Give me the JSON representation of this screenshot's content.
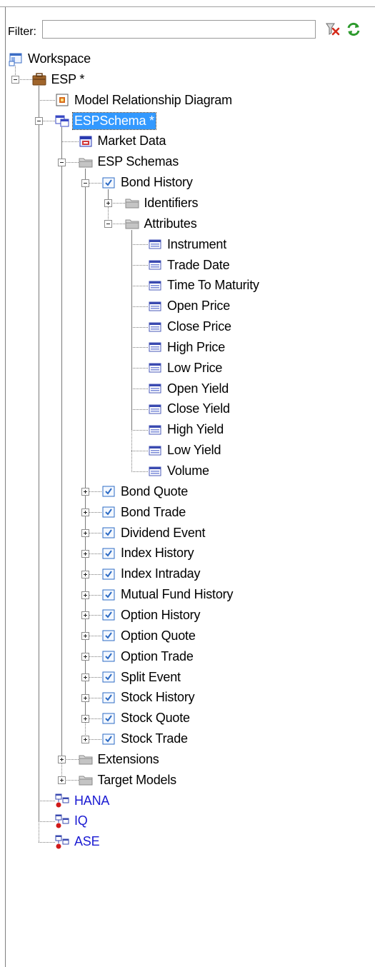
{
  "filter": {
    "label": "Filter:",
    "value": "",
    "clear_icon": "clear-filter-icon",
    "refresh_icon": "refresh-icon"
  },
  "colors": {
    "selection": "#3399ff",
    "model_link_text": "#1a1ad2"
  },
  "tree": [
    {
      "label": "Workspace",
      "icon": "workspace-icon",
      "level": 0,
      "toggle": "none"
    },
    {
      "label": "ESP *",
      "icon": "project-folder-icon",
      "level": 1,
      "toggle": "expanded"
    },
    {
      "label": "Model Relationship Diagram",
      "icon": "diagram-icon",
      "level": 2,
      "toggle": "none"
    },
    {
      "label": "ESPSchema *",
      "icon": "schema-icon",
      "level": 2,
      "toggle": "expanded",
      "selected": true
    },
    {
      "label": "Market Data",
      "icon": "database-icon",
      "level": 3,
      "toggle": "none"
    },
    {
      "label": "ESP Schemas",
      "icon": "folder-icon",
      "level": 3,
      "toggle": "expanded"
    },
    {
      "label": "Bond History",
      "icon": "schema-check-icon",
      "level": 4,
      "toggle": "expanded"
    },
    {
      "label": "Identifiers",
      "icon": "folder-icon",
      "level": 5,
      "toggle": "collapsed"
    },
    {
      "label": "Attributes",
      "icon": "folder-icon",
      "level": 5,
      "toggle": "expanded"
    },
    {
      "label": "Instrument",
      "icon": "attribute-icon",
      "level": 6,
      "toggle": "none"
    },
    {
      "label": "Trade Date",
      "icon": "attribute-icon",
      "level": 6,
      "toggle": "none"
    },
    {
      "label": "Time To Maturity",
      "icon": "attribute-icon",
      "level": 6,
      "toggle": "none"
    },
    {
      "label": "Open Price",
      "icon": "attribute-icon",
      "level": 6,
      "toggle": "none"
    },
    {
      "label": "Close Price",
      "icon": "attribute-icon",
      "level": 6,
      "toggle": "none"
    },
    {
      "label": "High Price",
      "icon": "attribute-icon",
      "level": 6,
      "toggle": "none"
    },
    {
      "label": "Low Price",
      "icon": "attribute-icon",
      "level": 6,
      "toggle": "none"
    },
    {
      "label": "Open Yield",
      "icon": "attribute-icon",
      "level": 6,
      "toggle": "none"
    },
    {
      "label": "Close Yield",
      "icon": "attribute-icon",
      "level": 6,
      "toggle": "none"
    },
    {
      "label": "High Yield",
      "icon": "attribute-icon",
      "level": 6,
      "toggle": "none"
    },
    {
      "label": "Low Yield",
      "icon": "attribute-icon",
      "level": 6,
      "toggle": "none"
    },
    {
      "label": "Volume",
      "icon": "attribute-icon",
      "level": 6,
      "toggle": "none"
    },
    {
      "label": "Bond Quote",
      "icon": "schema-check-icon",
      "level": 4,
      "toggle": "collapsed"
    },
    {
      "label": "Bond Trade",
      "icon": "schema-check-icon",
      "level": 4,
      "toggle": "collapsed"
    },
    {
      "label": "Dividend Event",
      "icon": "schema-check-icon",
      "level": 4,
      "toggle": "collapsed"
    },
    {
      "label": "Index History",
      "icon": "schema-check-icon",
      "level": 4,
      "toggle": "collapsed"
    },
    {
      "label": "Index Intraday",
      "icon": "schema-check-icon",
      "level": 4,
      "toggle": "collapsed"
    },
    {
      "label": "Mutual Fund History",
      "icon": "schema-check-icon",
      "level": 4,
      "toggle": "collapsed"
    },
    {
      "label": "Option History",
      "icon": "schema-check-icon",
      "level": 4,
      "toggle": "collapsed"
    },
    {
      "label": "Option Quote",
      "icon": "schema-check-icon",
      "level": 4,
      "toggle": "collapsed"
    },
    {
      "label": "Option Trade",
      "icon": "schema-check-icon",
      "level": 4,
      "toggle": "collapsed"
    },
    {
      "label": "Split Event",
      "icon": "schema-check-icon",
      "level": 4,
      "toggle": "collapsed"
    },
    {
      "label": "Stock History",
      "icon": "schema-check-icon",
      "level": 4,
      "toggle": "collapsed"
    },
    {
      "label": "Stock Quote",
      "icon": "schema-check-icon",
      "level": 4,
      "toggle": "collapsed"
    },
    {
      "label": "Stock Trade",
      "icon": "schema-check-icon",
      "level": 4,
      "toggle": "collapsed"
    },
    {
      "label": "Extensions",
      "icon": "folder-icon",
      "level": 3,
      "toggle": "collapsed"
    },
    {
      "label": "Target Models",
      "icon": "folder-icon",
      "level": 3,
      "toggle": "collapsed"
    },
    {
      "label": "HANA",
      "icon": "physical-model-icon",
      "level": 2,
      "toggle": "none",
      "link": true
    },
    {
      "label": "IQ",
      "icon": "physical-model-icon",
      "level": 2,
      "toggle": "none",
      "link": true
    },
    {
      "label": "ASE",
      "icon": "physical-model-icon",
      "level": 2,
      "toggle": "none",
      "link": true
    }
  ]
}
